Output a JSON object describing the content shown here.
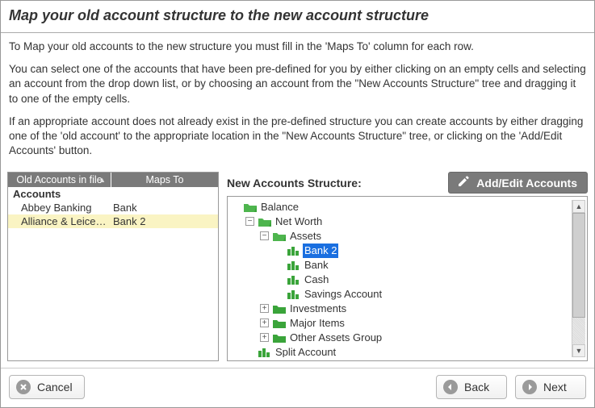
{
  "title": "Map your old account structure to the new account structure",
  "intro": {
    "p1": "To Map your old accounts to the new structure you must fill in the 'Maps To' column for each row.",
    "p2": "You can select one of the accounts that have been pre-defined for you by either clicking on an empty cells and selecting an account from the drop down list, or by choosing an account from the \"New Accounts Structure\" tree and dragging it to one of the empty cells.",
    "p3": "If an appropriate account does not already exist in the pre-defined structure you can create accounts by either dragging one of the 'old account' to the appropriate location in the \"New Accounts Structure\" tree, or clicking on the 'Add/Edit Accounts' button."
  },
  "left": {
    "col_a": "Old Accounts in file",
    "col_b": "Maps To",
    "group": "Accounts",
    "rows": [
      {
        "old": "Abbey Banking",
        "maps": "Bank"
      },
      {
        "old": "Alliance & Leice…",
        "maps": "Bank 2"
      }
    ]
  },
  "right": {
    "title": "New Accounts Structure:",
    "addedit": "Add/Edit Accounts"
  },
  "tree": {
    "balance": "Balance",
    "networth": "Net Worth",
    "assets": "Assets",
    "bank2": "Bank 2",
    "bank": "Bank",
    "cash": "Cash",
    "savings": "Savings Account",
    "investments": "Investments",
    "majoritems": "Major Items",
    "otherassets": "Other Assets Group",
    "splitacct": "Split Account"
  },
  "buttons": {
    "cancel": "Cancel",
    "back": "Back",
    "next": "Next"
  }
}
